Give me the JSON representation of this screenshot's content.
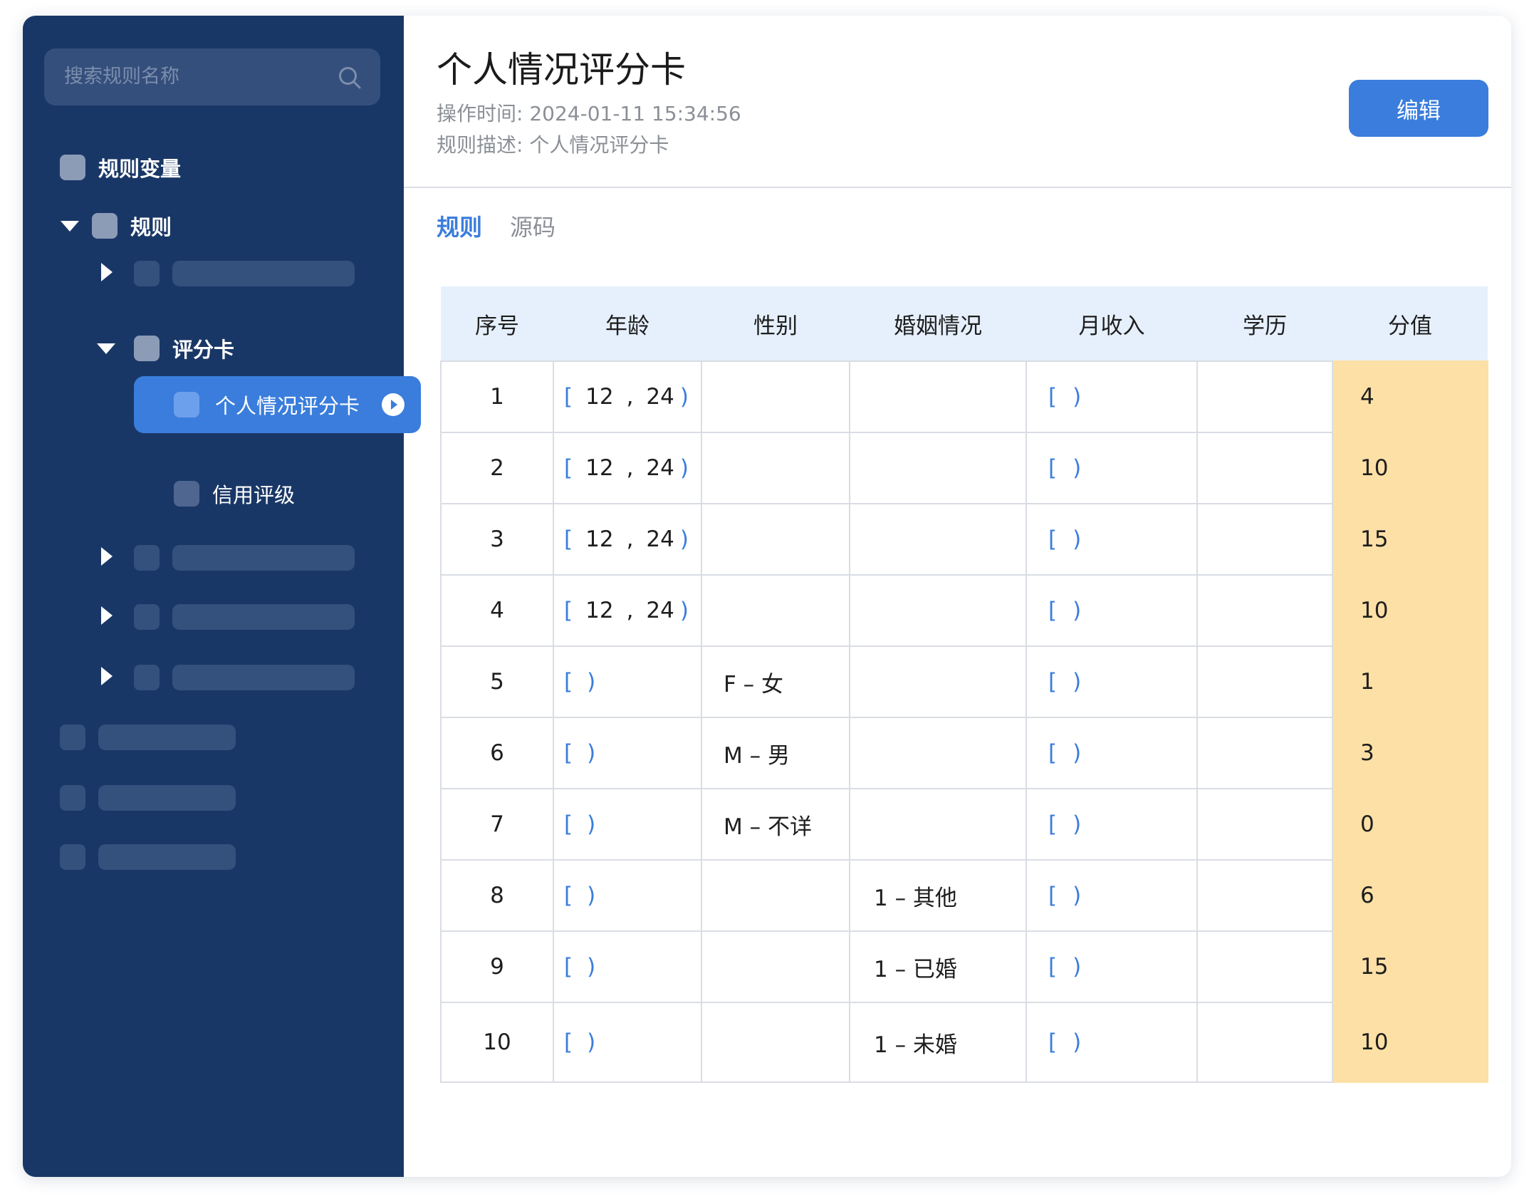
{
  "sidebar": {
    "search_placeholder": "搜索规则名称",
    "tree": {
      "variables_label": "规则变量",
      "rules_label": "规则",
      "scorecard_label": "评分卡",
      "active_item_label": "个人情况评分卡",
      "credit_label": "信用评级"
    }
  },
  "header": {
    "title": "个人情况评分卡",
    "op_time_label": "操作时间:",
    "op_time_value": "2024-01-11 15:34:56",
    "desc_label": "规则描述:",
    "desc_value": "个人情况评分卡",
    "edit_label": "编辑"
  },
  "tabs": [
    {
      "label": "规则",
      "active": true
    },
    {
      "label": "源码",
      "active": false
    }
  ],
  "table": {
    "columns": [
      "序号",
      "年龄",
      "性别",
      "婚姻情况",
      "月收入",
      "学历",
      "分值"
    ],
    "rows": [
      {
        "seq": "1",
        "age": [
          "[",
          "12",
          ",",
          "24",
          ")"
        ],
        "gender": "",
        "marriage": "",
        "income": [
          "[",
          ")"
        ],
        "edu": "",
        "score": "4"
      },
      {
        "seq": "2",
        "age": [
          "[",
          "12",
          ",",
          "24",
          ")"
        ],
        "gender": "",
        "marriage": "",
        "income": [
          "[",
          ")"
        ],
        "edu": "",
        "score": "10"
      },
      {
        "seq": "3",
        "age": [
          "[",
          "12",
          ",",
          "24",
          ")"
        ],
        "gender": "",
        "marriage": "",
        "income": [
          "[",
          ")"
        ],
        "edu": "",
        "score": "15"
      },
      {
        "seq": "4",
        "age": [
          "[",
          "12",
          ",",
          "24",
          ")"
        ],
        "gender": "",
        "marriage": "",
        "income": [
          "[",
          ")"
        ],
        "edu": "",
        "score": "10"
      },
      {
        "seq": "5",
        "age": [
          "[",
          "",
          "",
          "",
          ")"
        ],
        "gender": "F – 女",
        "marriage": "",
        "income": [
          "[",
          ")"
        ],
        "edu": "",
        "score": "1"
      },
      {
        "seq": "6",
        "age": [
          "[",
          "",
          "",
          "",
          ")"
        ],
        "gender": "M – 男",
        "marriage": "",
        "income": [
          "[",
          ")"
        ],
        "edu": "",
        "score": "3"
      },
      {
        "seq": "7",
        "age": [
          "[",
          "",
          "",
          "",
          ")"
        ],
        "gender": "M – 不详",
        "marriage": "",
        "income": [
          "[",
          ")"
        ],
        "edu": "",
        "score": "0"
      },
      {
        "seq": "8",
        "age": [
          "[",
          "",
          "",
          "",
          ")"
        ],
        "gender": "",
        "marriage": "1 – 其他",
        "income": [
          "[",
          ")"
        ],
        "edu": "",
        "score": "6"
      },
      {
        "seq": "9",
        "age": [
          "[",
          "",
          "",
          "",
          ")"
        ],
        "gender": "",
        "marriage": "1 – 已婚",
        "income": [
          "[",
          ")"
        ],
        "edu": "",
        "score": "15"
      },
      {
        "seq": "10",
        "age": [
          "[",
          "",
          "",
          "",
          ")"
        ],
        "gender": "",
        "marriage": "1 – 未婚",
        "income": [
          "[",
          ")"
        ],
        "edu": "",
        "score": "10"
      }
    ]
  },
  "colors": {
    "sidebar_bg": "#193766",
    "accent": "#3a7ddc",
    "score_bg": "#fde0a5",
    "header_bg": "#e6f0fd"
  }
}
